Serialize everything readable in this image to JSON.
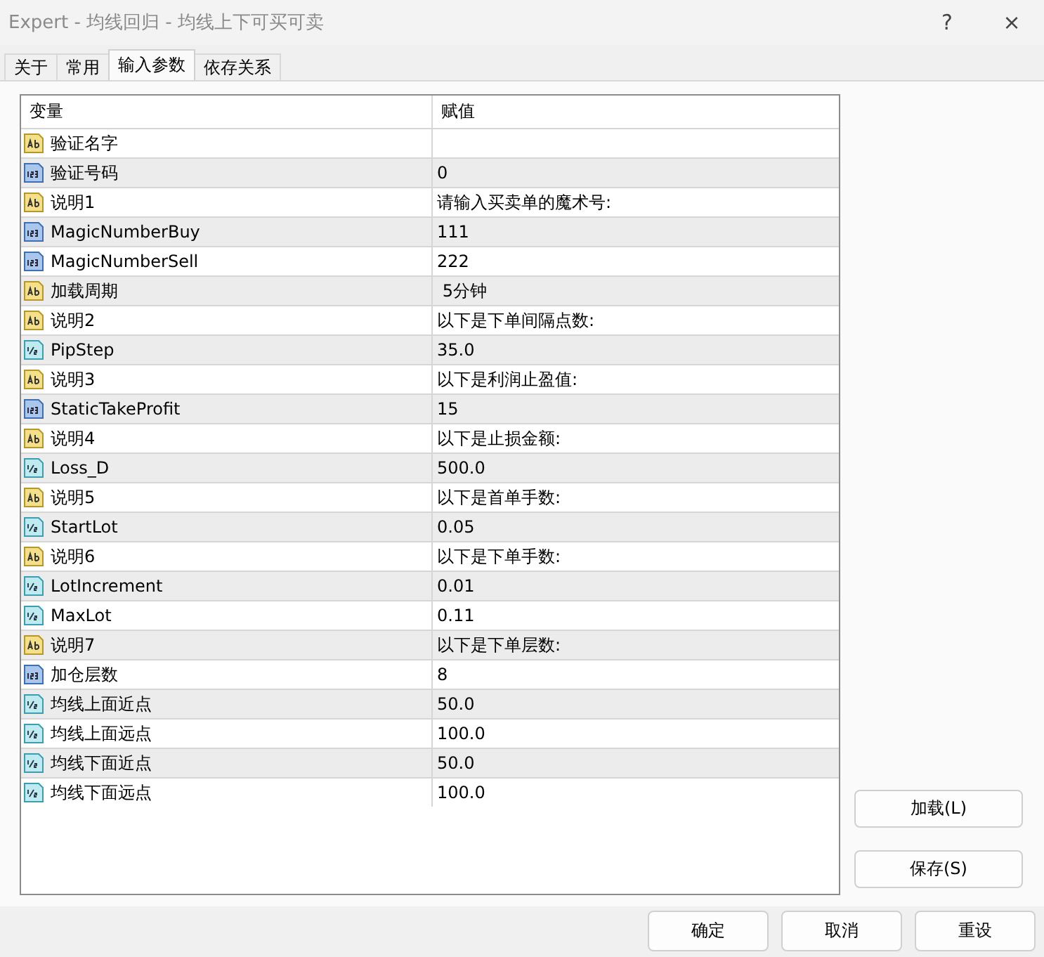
{
  "window": {
    "title": "Expert - 均线回归 - 均线上下可买可卖",
    "help": "?",
    "close": "×"
  },
  "tabs": [
    {
      "label": "关于",
      "selected": false
    },
    {
      "label": "常用",
      "selected": false
    },
    {
      "label": "输入参数",
      "selected": true
    },
    {
      "label": "依存关系",
      "selected": false
    }
  ],
  "table": {
    "columns": [
      "变量",
      "赋值"
    ],
    "rows": [
      {
        "kind": "string",
        "name": "验证名字",
        "value": ""
      },
      {
        "kind": "int",
        "name": "验证号码",
        "value": "0"
      },
      {
        "kind": "string",
        "name": "说明1",
        "value": "请输入买卖单的魔术号:"
      },
      {
        "kind": "int",
        "name": "MagicNumberBuy",
        "value": "111"
      },
      {
        "kind": "int",
        "name": "MagicNumberSell",
        "value": "222"
      },
      {
        "kind": "string",
        "name": "加载周期",
        "value": " 5分钟"
      },
      {
        "kind": "string",
        "name": "说明2",
        "value": "以下是下单间隔点数:"
      },
      {
        "kind": "double",
        "name": "PipStep",
        "value": "35.0"
      },
      {
        "kind": "string",
        "name": "说明3",
        "value": "以下是利润止盈值:"
      },
      {
        "kind": "int",
        "name": "StaticTakeProfit",
        "value": "15"
      },
      {
        "kind": "string",
        "name": "说明4",
        "value": "以下是止损金额:"
      },
      {
        "kind": "double",
        "name": "Loss_D",
        "value": "500.0"
      },
      {
        "kind": "string",
        "name": "说明5",
        "value": "以下是首单手数:"
      },
      {
        "kind": "double",
        "name": "StartLot",
        "value": "0.05"
      },
      {
        "kind": "string",
        "name": "说明6",
        "value": "以下是下单手数:"
      },
      {
        "kind": "double",
        "name": "LotIncrement",
        "value": "0.01"
      },
      {
        "kind": "double",
        "name": "MaxLot",
        "value": "0.11"
      },
      {
        "kind": "string",
        "name": "说明7",
        "value": "以下是下单层数:"
      },
      {
        "kind": "int",
        "name": "加仓层数",
        "value": "8"
      },
      {
        "kind": "double",
        "name": "均线上面近点",
        "value": "50.0"
      },
      {
        "kind": "double",
        "name": "均线上面远点",
        "value": "100.0"
      },
      {
        "kind": "double",
        "name": "均线下面近点",
        "value": "50.0"
      },
      {
        "kind": "double",
        "name": "均线下面远点",
        "value": "100.0"
      }
    ]
  },
  "side_buttons": [
    "加载(L)",
    "保存(S)"
  ],
  "buttons": [
    "确定",
    "取消",
    "重设"
  ]
}
